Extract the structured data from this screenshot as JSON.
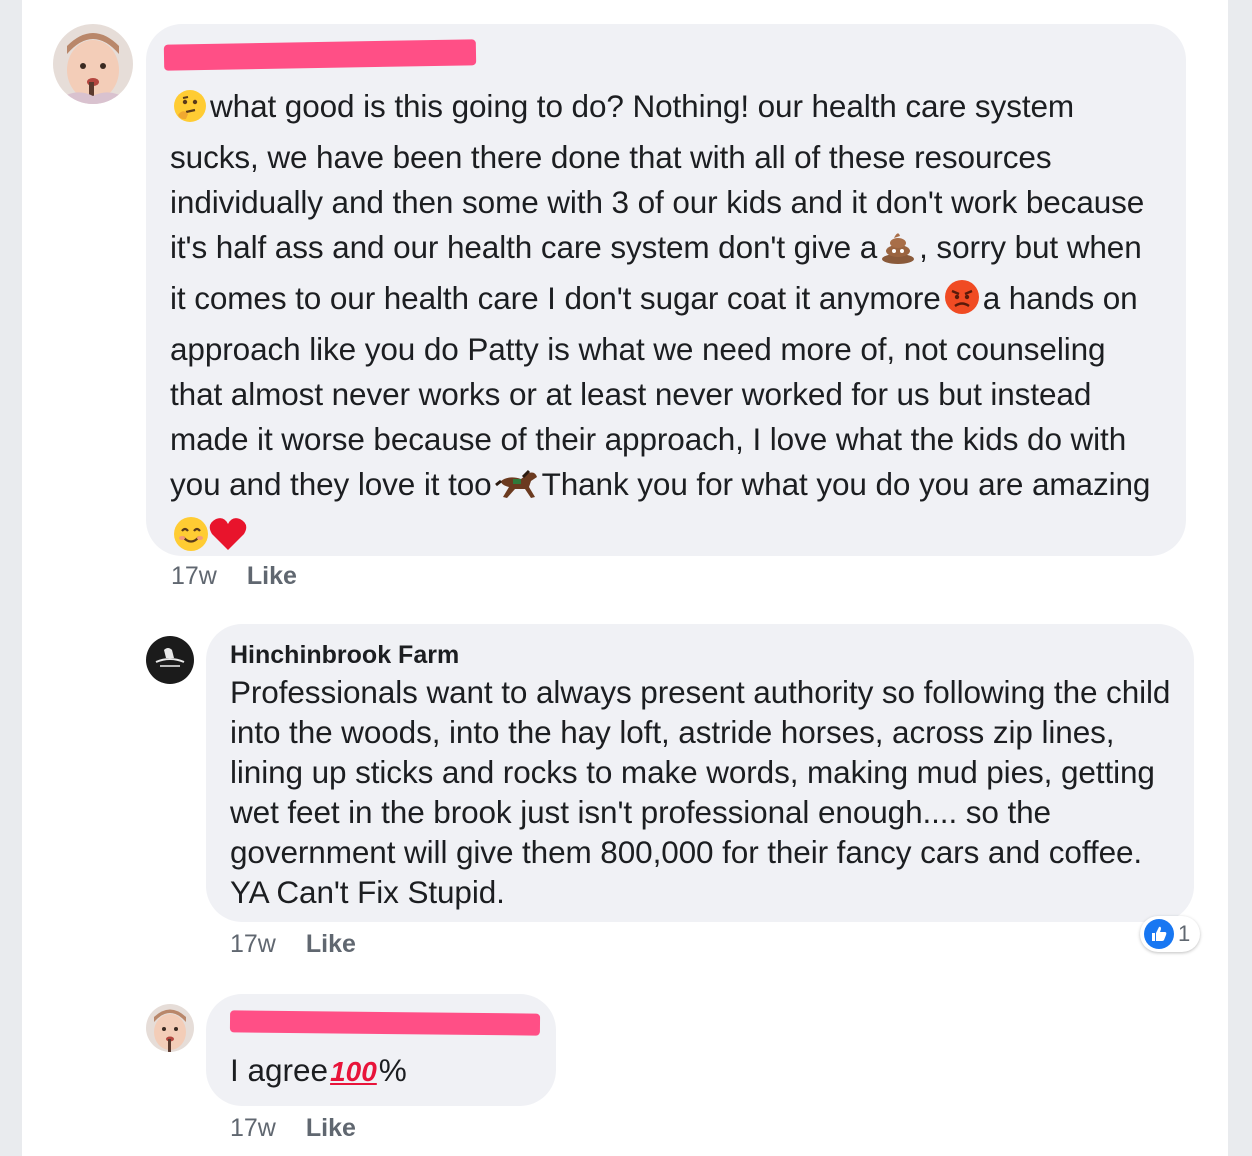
{
  "comments": [
    {
      "author": "",
      "segments": [
        "what good is this going to do? Nothing! our health care system sucks, we have been there done that with all of these resources individually and then some  with 3 of our kids and it don't work because it's half ass and our health care system don't give a",
        ", sorry but when it comes to our health care I don't sugar coat it anymore",
        "a hands on approach like you do Patty is what we need more of, not counseling that almost never works or at least never worked for us but instead made it worse because of their approach, I love what the kids do with you and they love it too",
        "Thank you for what you do you are amazing"
      ],
      "emojis": [
        "thinking-face",
        "pile-of-poo",
        "angry-face",
        "horse",
        "smiling-face",
        "red-heart"
      ],
      "time": "17w",
      "like_label": "Like"
    },
    {
      "author": "Hinchinbrook Farm",
      "text": "Professionals want to always present authority so following the child into the woods, into the hay loft, astride horses, across zip lines, lining up sticks and rocks to make words, making mud pies, getting wet feet in the brook just isn't professional enough.... so the government will give them 800,000 for their fancy cars and coffee.  YA Can't Fix Stupid.",
      "time": "17w",
      "like_label": "Like",
      "reaction_count": "1"
    },
    {
      "author": "",
      "text_before": "I agree",
      "hundred": "100",
      "text_after": "%",
      "time": "17w",
      "like_label": "Like"
    }
  ],
  "colors": {
    "bubble": "#f0f1f5",
    "redaction": "#ff4f86",
    "like_blue": "#1877f2",
    "meta_gray": "#606770"
  }
}
